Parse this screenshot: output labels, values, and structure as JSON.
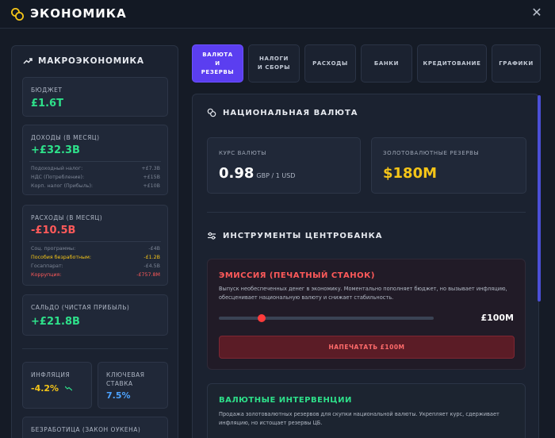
{
  "window": {
    "title": "ЭКОНОМИКА",
    "icon": "coins-icon",
    "close_icon": "close-icon"
  },
  "sidebar": {
    "header": "МАКРОЭКОНОМИКА",
    "header_icon": "trend-up-icon",
    "budget": {
      "label": "БЮДЖЕТ",
      "value": "£1.6T"
    },
    "income": {
      "label": "ДОХОДЫ (В МЕСЯЦ)",
      "value": "+£32.3B",
      "rows": [
        {
          "name": "Подоходный налог:",
          "value": "+£7.3B"
        },
        {
          "name": "НДС (Потребление):",
          "value": "+£15B"
        },
        {
          "name": "Корп. налог (Прибыль):",
          "value": "+£10B"
        }
      ]
    },
    "expenses": {
      "label": "РАСХОДЫ (В МЕСЯЦ)",
      "value": "-£10.5B",
      "rows": [
        {
          "name": "Соц. программы:",
          "value": "-£4B"
        },
        {
          "name": "Пособия безработным:",
          "value": "-£1.2B"
        },
        {
          "name": "Госаппарат:",
          "value": "-£4.5B"
        },
        {
          "name": "Коррупция:",
          "value": "-£757.8M"
        }
      ]
    },
    "balance": {
      "label": "САЛЬДО (ЧИСТАЯ ПРИБЫЛЬ)",
      "value": "+£21.8B"
    },
    "inflation": {
      "label": "ИНФЛЯЦИЯ",
      "value": "-4.2%",
      "trend_icon": "trend-down-icon"
    },
    "key_rate": {
      "label_line1": "КЛЮЧЕВАЯ",
      "label_line2": "СТАВКА",
      "value": "7.5%"
    },
    "unemployment": {
      "label": "БЕЗРАБОТИЦА (ЗАКОН ОУКЕНА)"
    }
  },
  "tabs": [
    {
      "line1": "ВАЛЮТА",
      "line2": "И",
      "line3": "РЕЗЕРВЫ",
      "active": true
    },
    {
      "line1": "НАЛОГИ",
      "line2": "И СБОРЫ",
      "line3": "",
      "active": false
    },
    {
      "line1": "РАСХОДЫ",
      "line2": "",
      "line3": "",
      "active": false
    },
    {
      "line1": "БАНКИ",
      "line2": "",
      "line3": "",
      "active": false
    },
    {
      "line1": "КРЕДИТОВАНИЕ",
      "line2": "",
      "line3": "",
      "active": false
    },
    {
      "line1": "ГРАФИКИ",
      "line2": "",
      "line3": "",
      "active": false
    }
  ],
  "currency": {
    "header": "НАЦИОНАЛЬНАЯ ВАЛЮТА",
    "header_icon": "coins-icon",
    "rate": {
      "label": "КУРС ВАЛЮТЫ",
      "value": "0.98",
      "unit": "GBP / 1 USD"
    },
    "reserves": {
      "label": "ЗОЛОТОВАЛЮТНЫЕ РЕЗЕРВЫ",
      "value": "$180M"
    }
  },
  "central_bank": {
    "header": "ИНСТРУМЕНТЫ ЦЕНТРОБАНКА",
    "header_icon": "sliders-icon",
    "emission": {
      "title": "ЭМИССИЯ (ПЕЧАТНЫЙ СТАНОК)",
      "description": "Выпуск необеспеченных денег в экономику. Моментально пополняет бюджет, но вызывает инфляцию, обесценивает национальную валюту и снижает стабильность.",
      "slider_value": "£100M",
      "slider_fraction": 0.2,
      "button": "НАПЕЧАТАТЬ £100M"
    },
    "intervention": {
      "title": "ВАЛЮТНЫЕ ИНТЕРВЕНЦИИ",
      "description": "Продажа золотовалютных резервов для скупки национальной валюты. Укрепляет курс, сдерживает инфляцию, но истощает резервы ЦБ."
    }
  }
}
